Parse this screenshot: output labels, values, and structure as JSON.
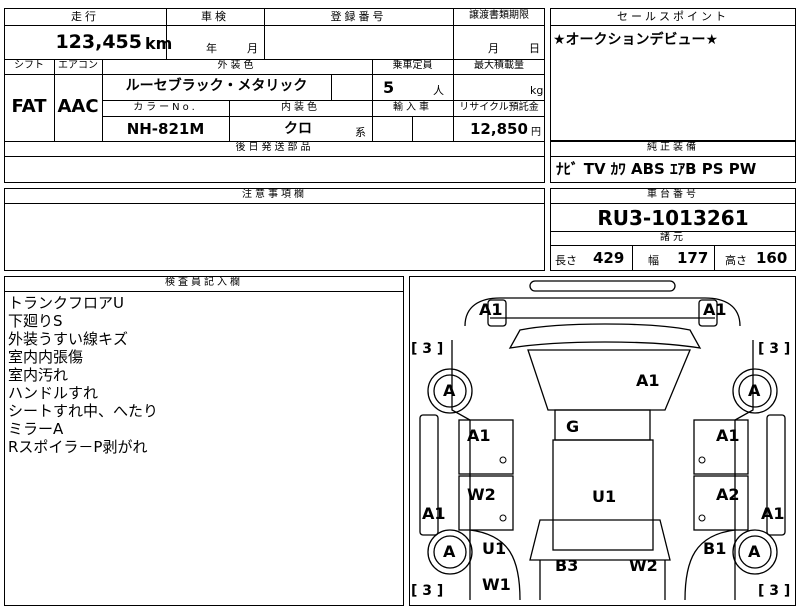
{
  "top_table": {
    "headers": {
      "mileage": "走行",
      "shaken": "車検",
      "registration_no": "登録番号",
      "transfer_deadline": "譲渡書類期限",
      "shift": "シフト",
      "aircon": "エアコン",
      "exterior_color": "外装色",
      "capacity": "乗車定員",
      "max_load": "最大積載量",
      "color_no": "カラーNo.",
      "interior_color": "内装色",
      "import": "輸入車",
      "recycle": "リサイクル預託金",
      "later_parts": "後日発送部品"
    },
    "mileage_value": "123,455",
    "mileage_unit": "km",
    "shaken_year": "年",
    "shaken_month": "月",
    "deadline_month": "月",
    "deadline_day": "日",
    "shift_value": "FAT",
    "aircon_value": "AAC",
    "exterior_value": "ルーセブラック・メタリック",
    "capacity_value": "5",
    "capacity_unit": "人",
    "load_unit": "kg",
    "color_no_value": "NH-821M",
    "interior_value": "クロ",
    "interior_suffix": "系",
    "recycle_value": "12,850",
    "recycle_unit": "円"
  },
  "sales_point": {
    "header": "セールスポイント",
    "text": "★オークションデビュー★"
  },
  "equipment": {
    "header": "純正装備",
    "text": "ﾅﾋﾞ TV ｶﾜ ABS ｴｱB PS PW"
  },
  "caution": {
    "header": "注意事項欄"
  },
  "chassis": {
    "header": "車台番号",
    "value": "RU3-1013261",
    "spec_header": "諸元",
    "length_label": "長さ",
    "length_value": "429",
    "width_label": "幅",
    "width_value": "177",
    "height_label": "高さ",
    "height_value": "160"
  },
  "inspector": {
    "header": "検査員記入欄",
    "remarks": [
      "トランクフロアU",
      "下廻りS",
      "外装うすい線キズ",
      "室内内張傷",
      "室内汚れ",
      "ハンドルすれ",
      "シートすれ中、へたり",
      "ミラーA",
      "Rスポイラ－P剥がれ"
    ]
  },
  "diagram": {
    "tire_label": "A",
    "bracket_value": "[ 3 ]",
    "marks": {
      "front_left": "A1",
      "front_right": "A1",
      "roof": "A1",
      "center_top": "G",
      "door_fl": "A1",
      "door_fr": "A1",
      "door_rl": "W2",
      "door_rr": "A2",
      "center": "U1",
      "side_left": "A1",
      "side_right": "A1",
      "rear_qtr_left": "U1",
      "rear_qtr_right": "B1",
      "bottom_left": "W1",
      "rear_left": "B3",
      "rear_right": "W2"
    }
  }
}
